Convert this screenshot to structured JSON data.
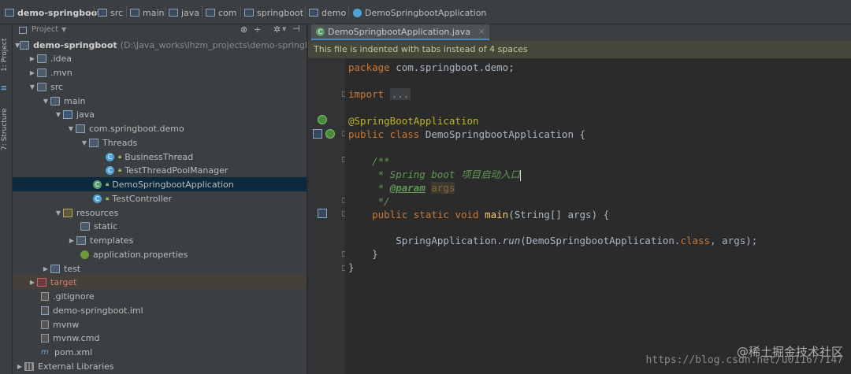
{
  "breadcrumb": [
    {
      "label": "demo-springboot",
      "bold": true
    },
    {
      "label": "src"
    },
    {
      "label": "main"
    },
    {
      "label": "java"
    },
    {
      "label": "com"
    },
    {
      "label": "springboot"
    },
    {
      "label": "demo"
    },
    {
      "label": "DemoSpringbootApplication"
    }
  ],
  "toolstrip": {
    "project_tab": "1: Project",
    "structure_tab": "7: Structure"
  },
  "project_panel": {
    "title": "Project",
    "tree": [
      {
        "label": "demo-springboot",
        "suffix": "(D:\\Java_works\\lhzm_projects\\demo-springboot)"
      },
      {
        "label": ".idea"
      },
      {
        "label": ".mvn"
      },
      {
        "label": "src"
      },
      {
        "label": "main"
      },
      {
        "label": "java"
      },
      {
        "label": "com.springboot.demo"
      },
      {
        "label": "Threads"
      },
      {
        "label": "BusinessThread"
      },
      {
        "label": "TestThreadPoolManager"
      },
      {
        "label": "DemoSpringbootApplication"
      },
      {
        "label": "TestController"
      },
      {
        "label": "resources"
      },
      {
        "label": "static"
      },
      {
        "label": "templates"
      },
      {
        "label": "application.properties"
      },
      {
        "label": "test"
      },
      {
        "label": "target"
      },
      {
        "label": ".gitignore"
      },
      {
        "label": "demo-springboot.iml"
      },
      {
        "label": "mvnw"
      },
      {
        "label": "mvnw.cmd"
      },
      {
        "label": "pom.xml"
      },
      {
        "label": "External Libraries"
      }
    ]
  },
  "editor": {
    "tab_label": "DemoSpringbootApplication.java",
    "notice": "This file is indented with tabs instead of 4 spaces",
    "code": {
      "package_kw": "package",
      "package_name": " com.springboot.demo;",
      "import_kw": "import",
      "import_fold": "...",
      "annotation": "@SpringBootApplication",
      "class_public": "public",
      "class_kw": " class",
      "class_name": " DemoSpringbootApplication {",
      "doc_open": "    /**",
      "doc_line1": "     * Spring boot 项目启动入口",
      "doc_star": "     * ",
      "doc_tag": "@param",
      "doc_param": "args",
      "doc_close": "     */",
      "main_sig_kw": "    public static void",
      "main_name": " main",
      "main_args": "(String[] args) {",
      "run_prefix": "        SpringApplication.",
      "run_call": "run",
      "run_args_a": "(DemoSpringbootApplication.",
      "run_class_kw": "class",
      "run_args_b": ", args);",
      "close_method": "    }",
      "close_class": "}"
    }
  },
  "watermark": {
    "text": "@稀土掘金技术社区",
    "url": "https://blog.csdn.net/u011677147"
  }
}
